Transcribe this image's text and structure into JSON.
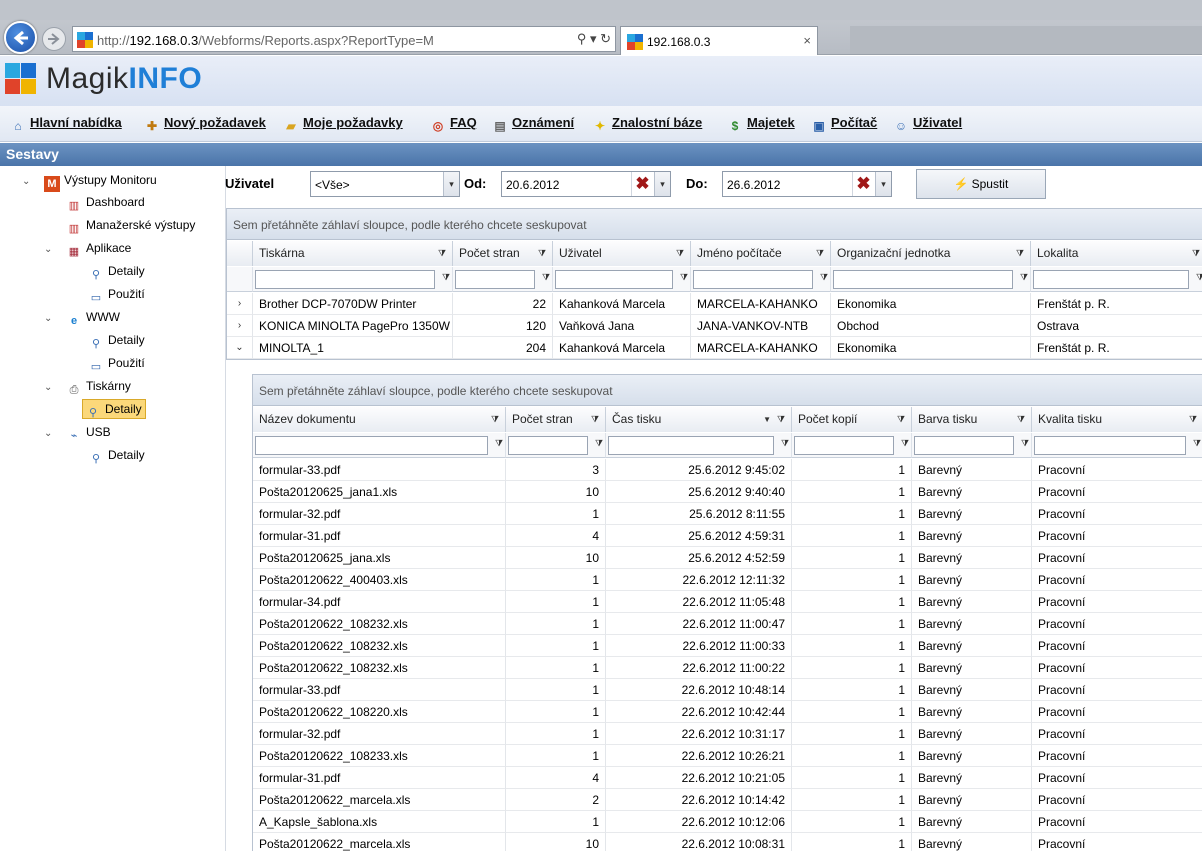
{
  "browser": {
    "url_prefix": "http://",
    "url_host": "192.168.0.3",
    "url_path": "/Webforms/Reports.aspx?ReportType=M",
    "addr_controls": "⚲ ▾ ↻",
    "tab_label": "192.168.0.3",
    "tab_close": "×"
  },
  "logo": {
    "part1": "Magik",
    "part2": "INFO"
  },
  "menu": [
    {
      "label": "Hlavní nabídka",
      "icon": "home-icon"
    },
    {
      "label": "Nový požadavek",
      "icon": "new-request-icon"
    },
    {
      "label": "Moje požadavky",
      "icon": "folder-icon"
    },
    {
      "label": "FAQ",
      "icon": "lifebuoy-icon"
    },
    {
      "label": "Oznámení",
      "icon": "announcement-icon"
    },
    {
      "label": "Znalostní báze",
      "icon": "lightbulb-icon"
    },
    {
      "label": "Majetek",
      "icon": "money-icon"
    },
    {
      "label": "Počítač",
      "icon": "computer-icon"
    },
    {
      "label": "Uživatel",
      "icon": "user-icon"
    }
  ],
  "section_title": "Sestavy",
  "tree": [
    {
      "label": "Výstupy Monitoru",
      "icon": "monitor-m-icon",
      "toggle": "⌄",
      "level": 0
    },
    {
      "label": "Dashboard",
      "icon": "chart-icon",
      "level": 1
    },
    {
      "label": "Manažerské výstupy",
      "icon": "chart-icon",
      "level": 1
    },
    {
      "label": "Aplikace",
      "icon": "apps-icon",
      "toggle": "⌄",
      "level": 1
    },
    {
      "label": "Detaily",
      "icon": "magnifier-icon",
      "level": 2
    },
    {
      "label": "Použití",
      "icon": "monitor-icon",
      "level": 2
    },
    {
      "label": "WWW",
      "icon": "ie-icon",
      "toggle": "⌄",
      "level": 1
    },
    {
      "label": "Detaily",
      "icon": "magnifier-icon",
      "level": 2
    },
    {
      "label": "Použití",
      "icon": "monitor-icon",
      "level": 2
    },
    {
      "label": "Tiskárny",
      "icon": "printer-icon",
      "toggle": "⌄",
      "level": 1
    },
    {
      "label": "Detaily",
      "icon": "magnifier-icon",
      "level": 2,
      "selected": true
    },
    {
      "label": "USB",
      "icon": "usb-icon",
      "toggle": "⌄",
      "level": 1
    },
    {
      "label": "Detaily",
      "icon": "magnifier-icon",
      "level": 2
    }
  ],
  "filters": {
    "user_label": "Uživatel",
    "user_value": "<Vše>",
    "from_label": "Od:",
    "from_value": "20.6.2012",
    "to_label": "Do:",
    "to_value": "26.6.2012",
    "run_label": "Spustit",
    "clear_glyph": "✖",
    "drop_glyph": "▾"
  },
  "outer_grid": {
    "group_hint": "Sem přetáhněte záhlaví sloupce, podle kterého chcete seskupovat",
    "columns": [
      "Tiskárna",
      "Počet stran",
      "Uživatel",
      "Jméno počítače",
      "Organizační jednotka",
      "Lokalita"
    ],
    "rows": [
      {
        "exp": "›",
        "cells": [
          "Brother DCP-7070DW Printer",
          "22",
          "Kahanková Marcela",
          "MARCELA-KAHANKO",
          "Ekonomika",
          "Frenštát p. R."
        ]
      },
      {
        "exp": "›",
        "cells": [
          "KONICA MINOLTA PagePro 1350W",
          "120",
          "Vaňková Jana",
          "JANA-VANKOV-NTB",
          "Obchod",
          "Ostrava"
        ]
      },
      {
        "exp": "⌄",
        "cells": [
          "MINOLTA_1",
          "204",
          "Kahanková Marcela",
          "MARCELA-KAHANKO",
          "Ekonomika",
          "Frenštát p. R."
        ]
      }
    ]
  },
  "inner_grid": {
    "group_hint": "Sem přetáhněte záhlaví sloupce, podle kterého chcete seskupovat",
    "columns": [
      "Název dokumentu",
      "Počet stran",
      "Čas tisku",
      "Počet kopií",
      "Barva tisku",
      "Kvalita tisku"
    ],
    "sorted_column_glyph": "▼",
    "rows": [
      [
        "formular-33.pdf",
        "3",
        "25.6.2012 9:45:02",
        "1",
        "Barevný",
        "Pracovní"
      ],
      [
        "Pošta20120625_jana1.xls",
        "10",
        "25.6.2012 9:40:40",
        "1",
        "Barevný",
        "Pracovní"
      ],
      [
        "formular-32.pdf",
        "1",
        "25.6.2012 8:11:55",
        "1",
        "Barevný",
        "Pracovní"
      ],
      [
        "formular-31.pdf",
        "4",
        "25.6.2012 4:59:31",
        "1",
        "Barevný",
        "Pracovní"
      ],
      [
        "Pošta20120625_jana.xls",
        "10",
        "25.6.2012 4:52:59",
        "1",
        "Barevný",
        "Pracovní"
      ],
      [
        "Pošta20120622_400403.xls",
        "1",
        "22.6.2012 12:11:32",
        "1",
        "Barevný",
        "Pracovní"
      ],
      [
        "formular-34.pdf",
        "1",
        "22.6.2012 11:05:48",
        "1",
        "Barevný",
        "Pracovní"
      ],
      [
        "Pošta20120622_108232.xls",
        "1",
        "22.6.2012 11:00:47",
        "1",
        "Barevný",
        "Pracovní"
      ],
      [
        "Pošta20120622_108232.xls",
        "1",
        "22.6.2012 11:00:33",
        "1",
        "Barevný",
        "Pracovní"
      ],
      [
        "Pošta20120622_108232.xls",
        "1",
        "22.6.2012 11:00:22",
        "1",
        "Barevný",
        "Pracovní"
      ],
      [
        "formular-33.pdf",
        "1",
        "22.6.2012 10:48:14",
        "1",
        "Barevný",
        "Pracovní"
      ],
      [
        "Pošta20120622_108220.xls",
        "1",
        "22.6.2012 10:42:44",
        "1",
        "Barevný",
        "Pracovní"
      ],
      [
        "formular-32.pdf",
        "1",
        "22.6.2012 10:31:17",
        "1",
        "Barevný",
        "Pracovní"
      ],
      [
        "Pošta20120622_108233.xls",
        "1",
        "22.6.2012 10:26:21",
        "1",
        "Barevný",
        "Pracovní"
      ],
      [
        "formular-31.pdf",
        "4",
        "22.6.2012 10:21:05",
        "1",
        "Barevný",
        "Pracovní"
      ],
      [
        "Pošta20120622_marcela.xls",
        "2",
        "22.6.2012 10:14:42",
        "1",
        "Barevný",
        "Pracovní"
      ],
      [
        "A_Kapsle_šablona.xls",
        "1",
        "22.6.2012 10:12:06",
        "1",
        "Barevný",
        "Pracovní"
      ],
      [
        "Pošta20120622_marcela.xls",
        "10",
        "22.6.2012 10:08:31",
        "1",
        "Barevný",
        "Pracovní"
      ]
    ]
  },
  "colors": {
    "accent": "#1f7fd7",
    "section_bar": "#4a74a9",
    "selected": "#fbd87a",
    "clear_red": "#a01818"
  }
}
